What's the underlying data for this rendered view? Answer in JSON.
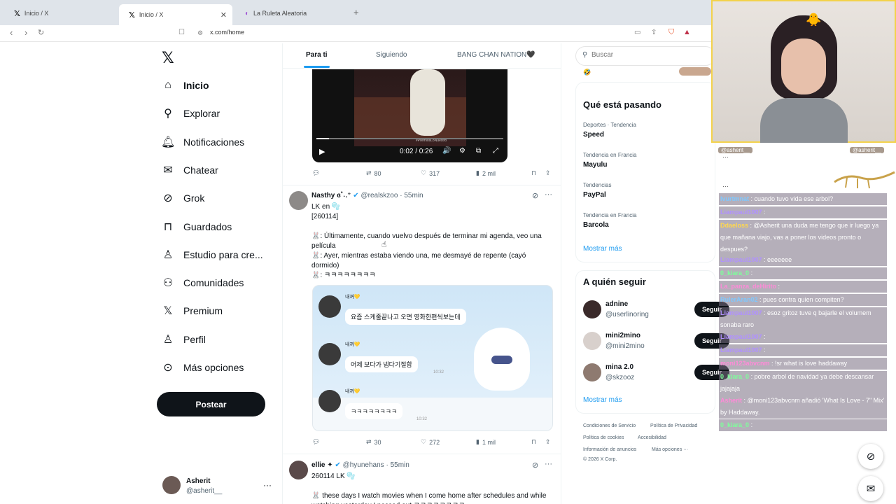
{
  "browser": {
    "tabs": [
      {
        "title": "Inicio / X"
      },
      {
        "title": "Inicio / X"
      },
      {
        "title": "La Ruleta Aleatoria"
      }
    ],
    "url": "x.com/home"
  },
  "sidebar": {
    "items": [
      {
        "label": "Inicio",
        "icon": "home-icon"
      },
      {
        "label": "Explorar",
        "icon": "search-icon"
      },
      {
        "label": "Notificaciones",
        "icon": "bell-icon"
      },
      {
        "label": "Chatear",
        "icon": "mail-icon"
      },
      {
        "label": "Grok",
        "icon": "grok-icon"
      },
      {
        "label": "Guardados",
        "icon": "bookmark-icon"
      },
      {
        "label": "Estudio para cre...",
        "icon": "studio-icon"
      },
      {
        "label": "Comunidades",
        "icon": "communities-icon"
      },
      {
        "label": "Premium",
        "icon": "x-icon"
      },
      {
        "label": "Perfil",
        "icon": "person-icon"
      },
      {
        "label": "Más opciones",
        "icon": "more-icon"
      }
    ],
    "post_label": "Postear",
    "account": {
      "name": "Asherit",
      "handle": "@asherit__"
    }
  },
  "feed": {
    "tabs": [
      "Para ti",
      "Siguiendo",
      "BANG CHAN NATION🖤"
    ],
    "video": {
      "time": "0:02 / 0:26",
      "watermark": "#PremiosLoNuestro"
    },
    "tweet0_actions": {
      "retweets": "80",
      "likes": "317",
      "views": "2 mil"
    },
    "tweet1": {
      "name": "Nasthy ɞ˚˖.⁺",
      "handle": "@realskzoo",
      "time": "55min",
      "lines": [
        "LK en 🫧",
        "[260114]",
        "🐰: Últimamente, cuando vuelvo después de terminar mi agenda, veo una película",
        "🐰: Ayer, mientras estaba viendo una, me desmayé de repente (cayó dormido)",
        "🐰: ㅋㅋㅋㅋㅋㅋㅋㅋ"
      ],
      "chat": [
        {
          "sender": "내꺼💛",
          "text": "요즘 스케줄끝나고 오면 영화한편씩보는데"
        },
        {
          "sender": "내꺼💛",
          "text": "어제 보다가 넵다기절함",
          "time": "10:32"
        },
        {
          "sender": "내꺼💛",
          "text": "ㅋㅋㅋㅋㅋㅋㅋㅋ",
          "time": "10:32"
        }
      ],
      "actions": {
        "retweets": "30",
        "likes": "272",
        "views": "1 mil"
      }
    },
    "tweet2": {
      "name": "ellie ✦",
      "handle": "@hyunehans",
      "time": "55min",
      "lines": [
        "260114 LK 🫧",
        "🐰 these days I watch movies when I come home after schedules and while watching yesterday I passed out ㅋㅋㅋㅋㅋㅋㅋㅋ"
      ]
    }
  },
  "right": {
    "search_placeholder": "Buscar",
    "trending_title": "Qué está pasando",
    "trends": [
      {
        "category": "Deportes · Tendencia",
        "name": "Speed"
      },
      {
        "category": "Tendencia en Francia",
        "name": "Mayulu"
      },
      {
        "category": "Tendencias",
        "name": "PayPal"
      },
      {
        "category": "Tendencia en Francia",
        "name": "Barcola"
      }
    ],
    "show_more": "Mostrar más",
    "follow_title": "A quién seguir",
    "follow": [
      {
        "name": "adnine",
        "handle": "@userlinoring"
      },
      {
        "name": "mini2mino",
        "handle": "@mini2mino"
      },
      {
        "name": "mina 2.0",
        "handle": "@skzooz"
      }
    ],
    "follow_label": "Seguir",
    "footer": [
      "Condiciones de Servicio",
      "Política de Privacidad",
      "Política de cookies",
      "Accesibilidad",
      "Información de anuncios",
      "Más opciones ···",
      "© 2026 X Corp."
    ]
  },
  "stream_chat": {
    "header_left": "@asherit__",
    "header_right": "@asherit__",
    "messages": [
      {
        "user": "lvurtmnat",
        "text": ": cuando tuvo vida ese arbol?"
      },
      {
        "user": "Liampaul1007",
        "text": ":"
      },
      {
        "user": "Ddaeloss",
        "text": ": @Asherit una duda me tengo que ir luego ya que mañana viajo, vas a poner los videos pronto o despues?"
      },
      {
        "user": "Liampaul1007",
        "text": ": eeeeeee"
      },
      {
        "user": "0_kiara_0",
        "text": ":"
      },
      {
        "user": "La_panza_deHirito",
        "text": ":"
      },
      {
        "user": "RulerAran02",
        "text": ": pues contra quien compiten?"
      },
      {
        "user": "Liampaul1007",
        "text": ": esoz gritoz tuve q bajarle el volumem sonaba raro"
      },
      {
        "user": "Liampaul1007",
        "text": ":"
      },
      {
        "user": "Liampaul1007",
        "text": ":"
      },
      {
        "user": "moni123abvcnm",
        "text": ": !sr what is love haddaway"
      },
      {
        "user": "0_kiara_0",
        "text": ": pobre arbol de navidad ya debe descansar jajajaja"
      },
      {
        "user": "Asherit",
        "text": ": @moni123abvcnm añadió 'What Is Love - 7\" Mix' by Haddaway."
      },
      {
        "user": "0_kiara_0",
        "text": ":"
      }
    ]
  },
  "colors": {
    "accent": "#1d9bf0",
    "dark": "#0f1419",
    "muted": "#536471"
  }
}
